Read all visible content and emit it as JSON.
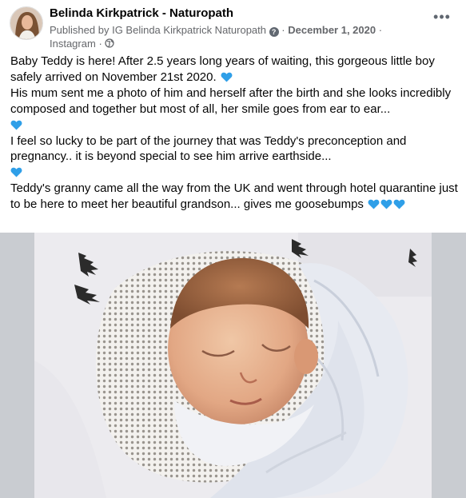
{
  "post": {
    "author": "Belinda Kirkpatrick - Naturopath",
    "published_prefix": "Published by",
    "publisher": "IG Belinda Kirkpatrick Naturopath",
    "help_icon": "question-icon",
    "separator": "·",
    "date": "December 1, 2020",
    "source": "Instagram",
    "audience_icon": "globe-icon",
    "more_label": "•••"
  },
  "body": {
    "p1": "Baby Teddy is here! After 2.5 years long years of waiting, this gorgeous little boy safely arrived on November 21st 2020.",
    "p2": "His mum sent me a photo of him and herself after the birth and she looks incredibly composed and together but most of all, her smile goes from ear to ear...",
    "p3": "I feel so lucky to be part of the journey that was Teddy's preconception and pregnancy.. it is beyond special to see him arrive earthside...",
    "p4": "Teddy's granny came all the way from the UK and went through hotel quarantine just to be here to meet her beautiful grandson... gives me goosebumps",
    "emoji_name": "blue-heart-icon"
  },
  "colors": {
    "heart": "#2f9fe8",
    "meta": "#65676b",
    "frame": "#c9ccd1"
  }
}
